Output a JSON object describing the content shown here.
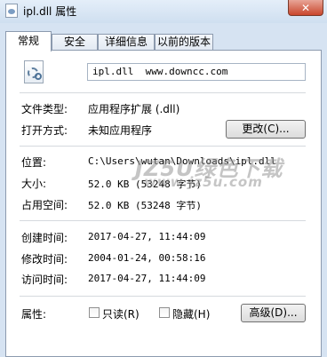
{
  "window": {
    "title": "ipl.dll 属性",
    "close_glyph": "✕"
  },
  "tabs": [
    {
      "label": "常规",
      "active": true
    },
    {
      "label": "安全",
      "active": false
    },
    {
      "label": "详细信息",
      "active": false
    },
    {
      "label": "以前的版本",
      "active": false
    }
  ],
  "general": {
    "file_name": "ipl.dll  www.downcc.com",
    "file_type_label": "文件类型:",
    "file_type_value": "应用程序扩展 (.dll)",
    "opens_with_label": "打开方式:",
    "opens_with_value": "未知应用程序",
    "change_button": "更改(C)...",
    "location_label": "位置:",
    "location_value": "C:\\Users\\wutan\\Downloads\\ipl.dll",
    "size_label": "大小:",
    "size_value": "52.0 KB (53248 字节)",
    "size_on_disk_label": "占用空间:",
    "size_on_disk_value": "52.0 KB (53248 字节)",
    "created_label": "创建时间:",
    "created_value": "2017-04-27, 11:44:09",
    "modified_label": "修改时间:",
    "modified_value": "2004-01-24, 00:58:16",
    "accessed_label": "访问时间:",
    "accessed_value": "2017-04-27, 11:44:09",
    "attributes_label": "属性:",
    "readonly_label": "只读(R)",
    "readonly_checked": false,
    "hidden_label": "隐藏(H)",
    "hidden_checked": false,
    "advanced_button": "高级(D)..."
  },
  "watermark": {
    "line1": "JZ5U绿色下载",
    "line2": "www.jz5u.com"
  }
}
